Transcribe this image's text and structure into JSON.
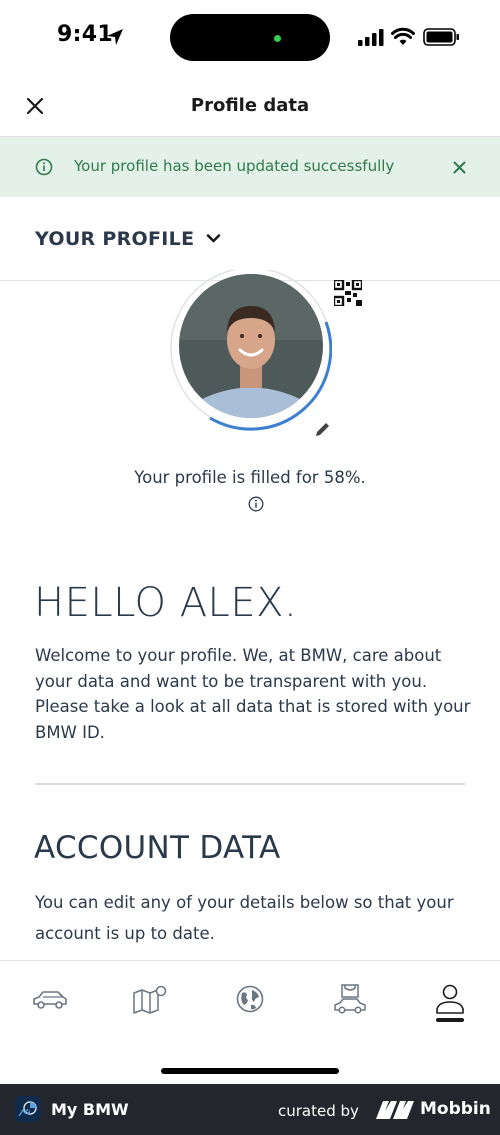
{
  "status_bar": {
    "time": "9:41"
  },
  "header": {
    "title": "Profile data"
  },
  "banner": {
    "message": "Your profile has been updated successfully"
  },
  "profile": {
    "section_label": "YOUR PROFILE",
    "filled_text": "Your profile is filled for 58%.",
    "filled_percent": 58
  },
  "greeting": {
    "title": "HELLO ALEX.",
    "text": "Welcome to your profile. We, at BMW, care about your data and want to be transparent with you. Please take a look at all data that is stored with your BMW ID."
  },
  "account": {
    "title": "ACCOUNT DATA",
    "text": "You can edit any of your details below so that your account is up to date."
  },
  "tabs": [
    {
      "icon": "car-icon"
    },
    {
      "icon": "map-icon"
    },
    {
      "icon": "globe-icon"
    },
    {
      "icon": "car-service-icon"
    },
    {
      "icon": "profile-icon",
      "active": true
    }
  ],
  "footer": {
    "app_name": "My BMW",
    "curated_by": "curated by",
    "brand": "Mobbin"
  },
  "colors": {
    "banner_bg": "#e3f1e8",
    "banner_text": "#2f7a4c",
    "text_dark": "#2b3a4a",
    "ring": "#3e7fd0",
    "footer_bg": "#23272d"
  }
}
